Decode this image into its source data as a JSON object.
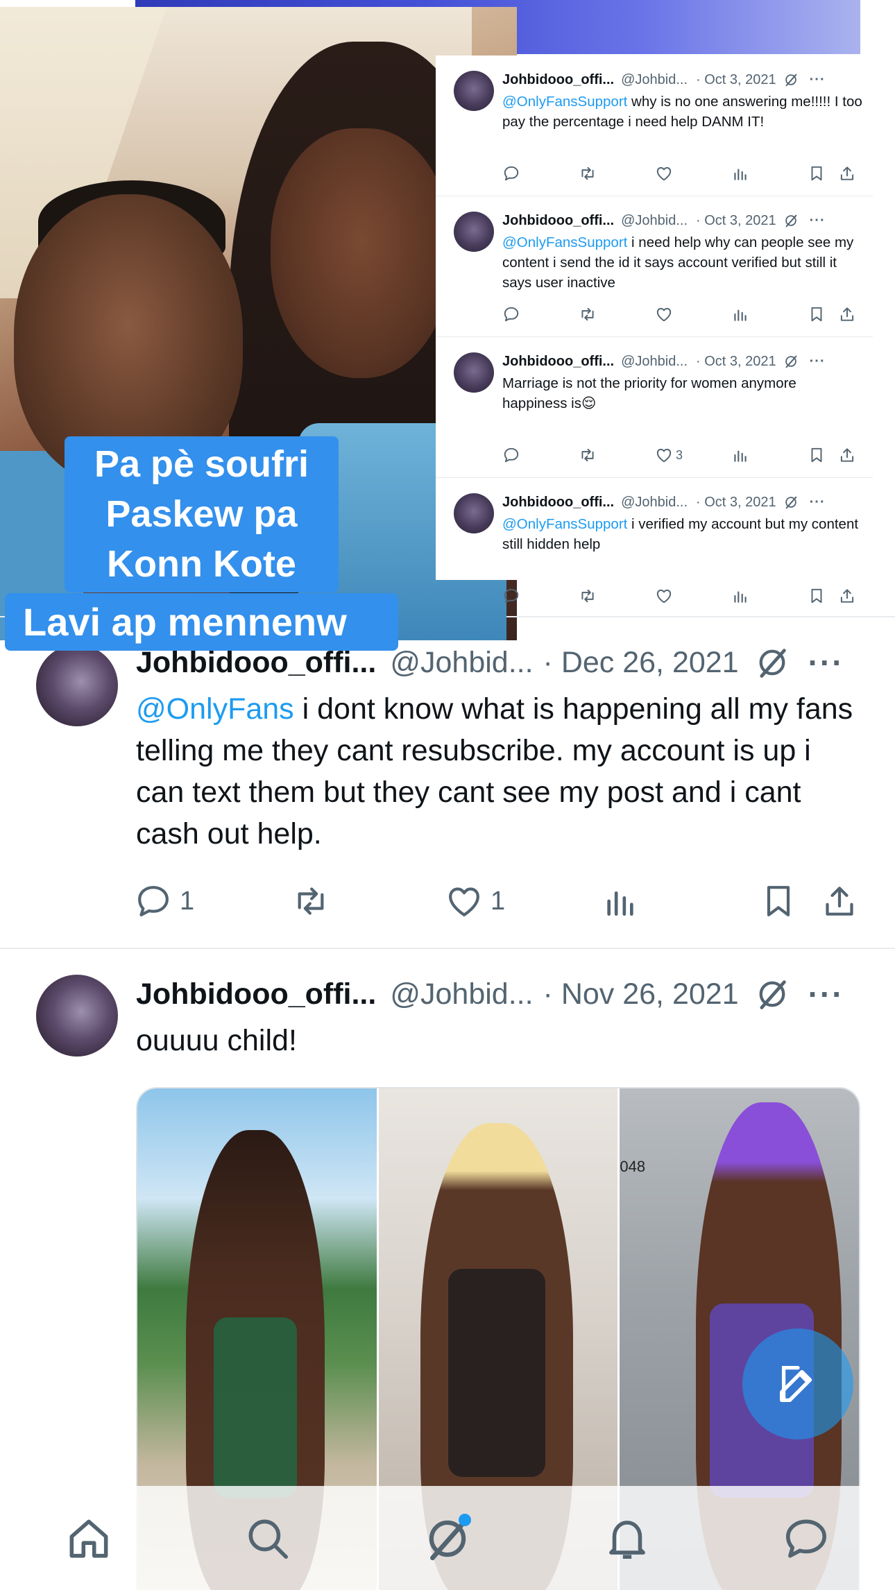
{
  "caption": {
    "lines": [
      "Pa pè soufri",
      "Paskew pa",
      "Konn Kote"
    ],
    "last_line": "Lavi ap mennenw"
  },
  "embedded_tweets": [
    {
      "name": "Johbidooo_offi...",
      "handle": "@Johbid...",
      "date": "· Oct 3, 2021",
      "mention": "@OnlyFansSupport",
      "text": " why is no one answering me!!!!! I too pay the percentage i need help DANM IT!",
      "likes": ""
    },
    {
      "name": "Johbidooo_offi...",
      "handle": "@Johbid...",
      "date": "· Oct 3, 2021",
      "mention": "@OnlyFansSupport",
      "text": " i need help why can people see my content i send the id it says account verified but still it says user inactive",
      "likes": ""
    },
    {
      "name": "Johbidooo_offi...",
      "handle": "@Johbid...",
      "date": "· Oct 3, 2021",
      "mention": "",
      "text": "Marriage is not the priority for women anymore happiness is😌",
      "likes": "3"
    },
    {
      "name": "Johbidooo_offi...",
      "handle": "@Johbid...",
      "date": "· Oct 3, 2021",
      "mention": "@OnlyFansSupport",
      "text": " i verified my account but my content still hidden help",
      "likes": ""
    }
  ],
  "tweet_1": {
    "name": "Johbidooo_offi...",
    "handle": "@Johbid...",
    "date": "· Dec 26, 2021",
    "mention": "@OnlyFans",
    "text": " i dont know what is happening all my fans telling me they cant resubscribe. my account is up i can text them but they cant see my post and i cant cash out help.",
    "replies": "1",
    "likes": "1"
  },
  "tweet_2": {
    "name": "Johbidooo_offi...",
    "handle": "@Johbid...",
    "date": "· Nov 26, 2021",
    "text": "ouuuu child!",
    "media_text": "048"
  },
  "icons": {
    "reply": "reply-icon",
    "retweet": "retweet-icon",
    "like": "heart-icon",
    "views": "views-icon",
    "bookmark": "bookmark-icon",
    "share": "share-icon",
    "grok": "grok-icon",
    "more": "more-icon",
    "compose": "compose-icon",
    "home": "home-icon",
    "search": "search-icon",
    "notifications": "bell-icon",
    "messages": "messages-icon"
  },
  "colors": {
    "accent": "#1d9bf0",
    "caption_bg": "#3390ec",
    "text_secondary": "#536471"
  }
}
